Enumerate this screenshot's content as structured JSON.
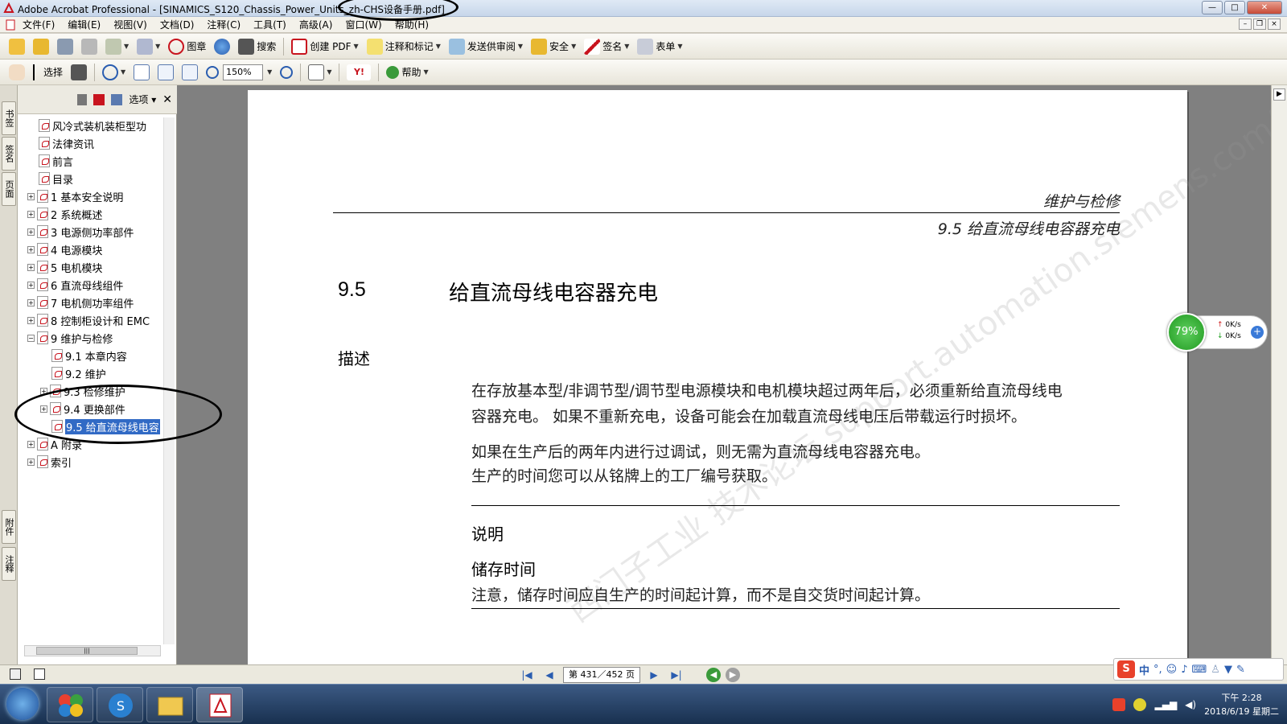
{
  "window": {
    "title": "Adobe Acrobat Professional - [SINAMICS_S120_Chassis_Power_Units_zh-CHS设备手册.pdf]"
  },
  "menu": [
    "文件(F)",
    "编辑(E)",
    "视图(V)",
    "文档(D)",
    "注释(C)",
    "工具(T)",
    "高级(A)",
    "窗口(W)",
    "帮助(H)"
  ],
  "toolbar1": {
    "stamp": "图章",
    "search": "搜索",
    "create_pdf": "创建 PDF",
    "comment": "注释和标记",
    "send_review": "发送供审阅",
    "secure": "安全",
    "sign": "签名",
    "forms": "表单"
  },
  "toolbar2": {
    "select": "选择",
    "zoom": "150%",
    "help": "帮助"
  },
  "navtabs": [
    "书签",
    "签名",
    "页面",
    "附件",
    "注释"
  ],
  "bookmarks": {
    "options_label": "选项",
    "items": [
      "风冷式装机装柜型功",
      "法律资讯",
      "前言",
      "目录",
      "1 基本安全说明",
      "2 系统概述",
      "3 电源侧功率部件",
      "4 电源模块",
      "5 电机模块",
      "6 直流母线组件",
      "7 电机侧功率组件",
      "8 控制柜设计和 EMC",
      "9 维护与检修",
      "9.1 本章内容",
      "9.2 维护",
      "9.3 检修维护",
      "9.4 更换部件",
      "9.5 给直流母线电容",
      "A 附录",
      "索引"
    ]
  },
  "page": {
    "running_head_chapter": "维护与检修",
    "running_head_section": "9.5 给直流母线电容器充电",
    "section_number": "9.5",
    "section_title": "给直流母线电容器充电",
    "description_heading": "描述",
    "para1_line1": "在存放基本型/非调节型/调节型电源模块和电机模块超过两年后，必须重新给直流母线电",
    "para1_line2": "容器充电。 如果不重新充电，设备可能会在加载直流母线电压后带载运行时损坏。",
    "para2_line1": "如果在生产后的两年内进行过调试，则无需为直流母线电容器充电。",
    "para2_line2": "生产的时间您可以从铭牌上的工厂编号获取。",
    "note_heading": "说明",
    "storage_heading": "储存时间",
    "storage_text": "注意，储存时间应自生产的时间起计算，而不是自交货时间起计算。",
    "watermark": "西门子工业  技术论坛  support.automation.siemens.com/cs"
  },
  "widget": {
    "percent": "79%",
    "up_speed": "0K/s",
    "down_speed": "0K/s"
  },
  "statusbar": {
    "page_indicator": "第 431／452 页"
  },
  "ime": {
    "label": "中"
  },
  "taskbar": {
    "time": "下午 2:28",
    "date": "2018/6/19 星期二"
  }
}
